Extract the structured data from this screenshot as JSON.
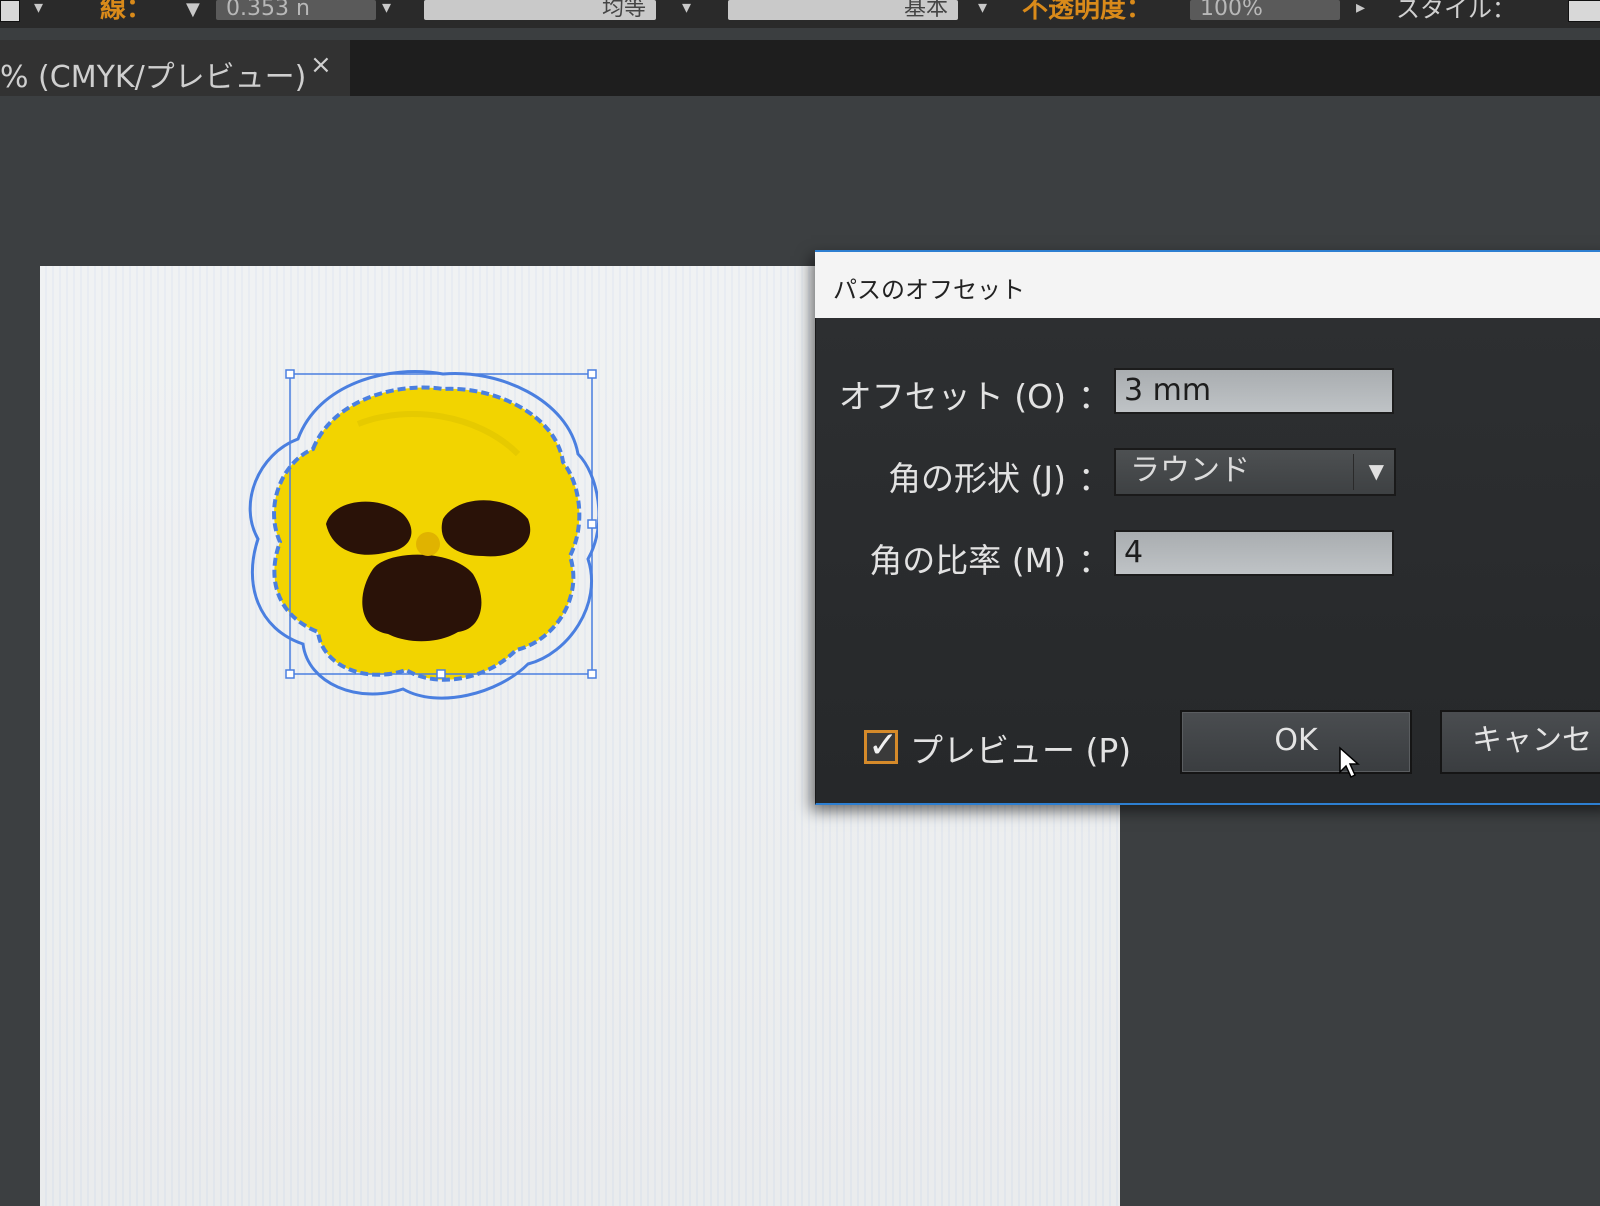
{
  "control_bar": {
    "stroke_label": "線：",
    "stroke_width": "0.353 n",
    "profile": "均等",
    "brush": "基本",
    "opacity_label": "不透明度：",
    "opacity_value": "100%",
    "style_label": "スタイル："
  },
  "document_tab": {
    "title": "% (CMYK/プレビュー)",
    "close": "×"
  },
  "dialog": {
    "title": "パスのオフセット",
    "offset_label": "オフセット (O)",
    "offset_value": "3 mm",
    "join_label": "角の形状 (J)",
    "join_value": "ラウンド",
    "miter_label": "角の比率 (M)",
    "miter_value": "4",
    "colon": "：",
    "preview_label": "プレビュー (P)",
    "preview_checked": true,
    "ok_label": "OK",
    "cancel_label": "キャンセ"
  },
  "colors": {
    "accent": "#d98a1a",
    "selection": "#4a7fe0",
    "dialog_border": "#2d7fd1",
    "pansy_petal": "#f2d400",
    "pansy_blotch": "#2a1208"
  },
  "icons": {
    "close": "close-icon",
    "dropdown": "chevron-down-icon",
    "check": "checkmark-icon",
    "cursor": "arrow-cursor-icon"
  }
}
